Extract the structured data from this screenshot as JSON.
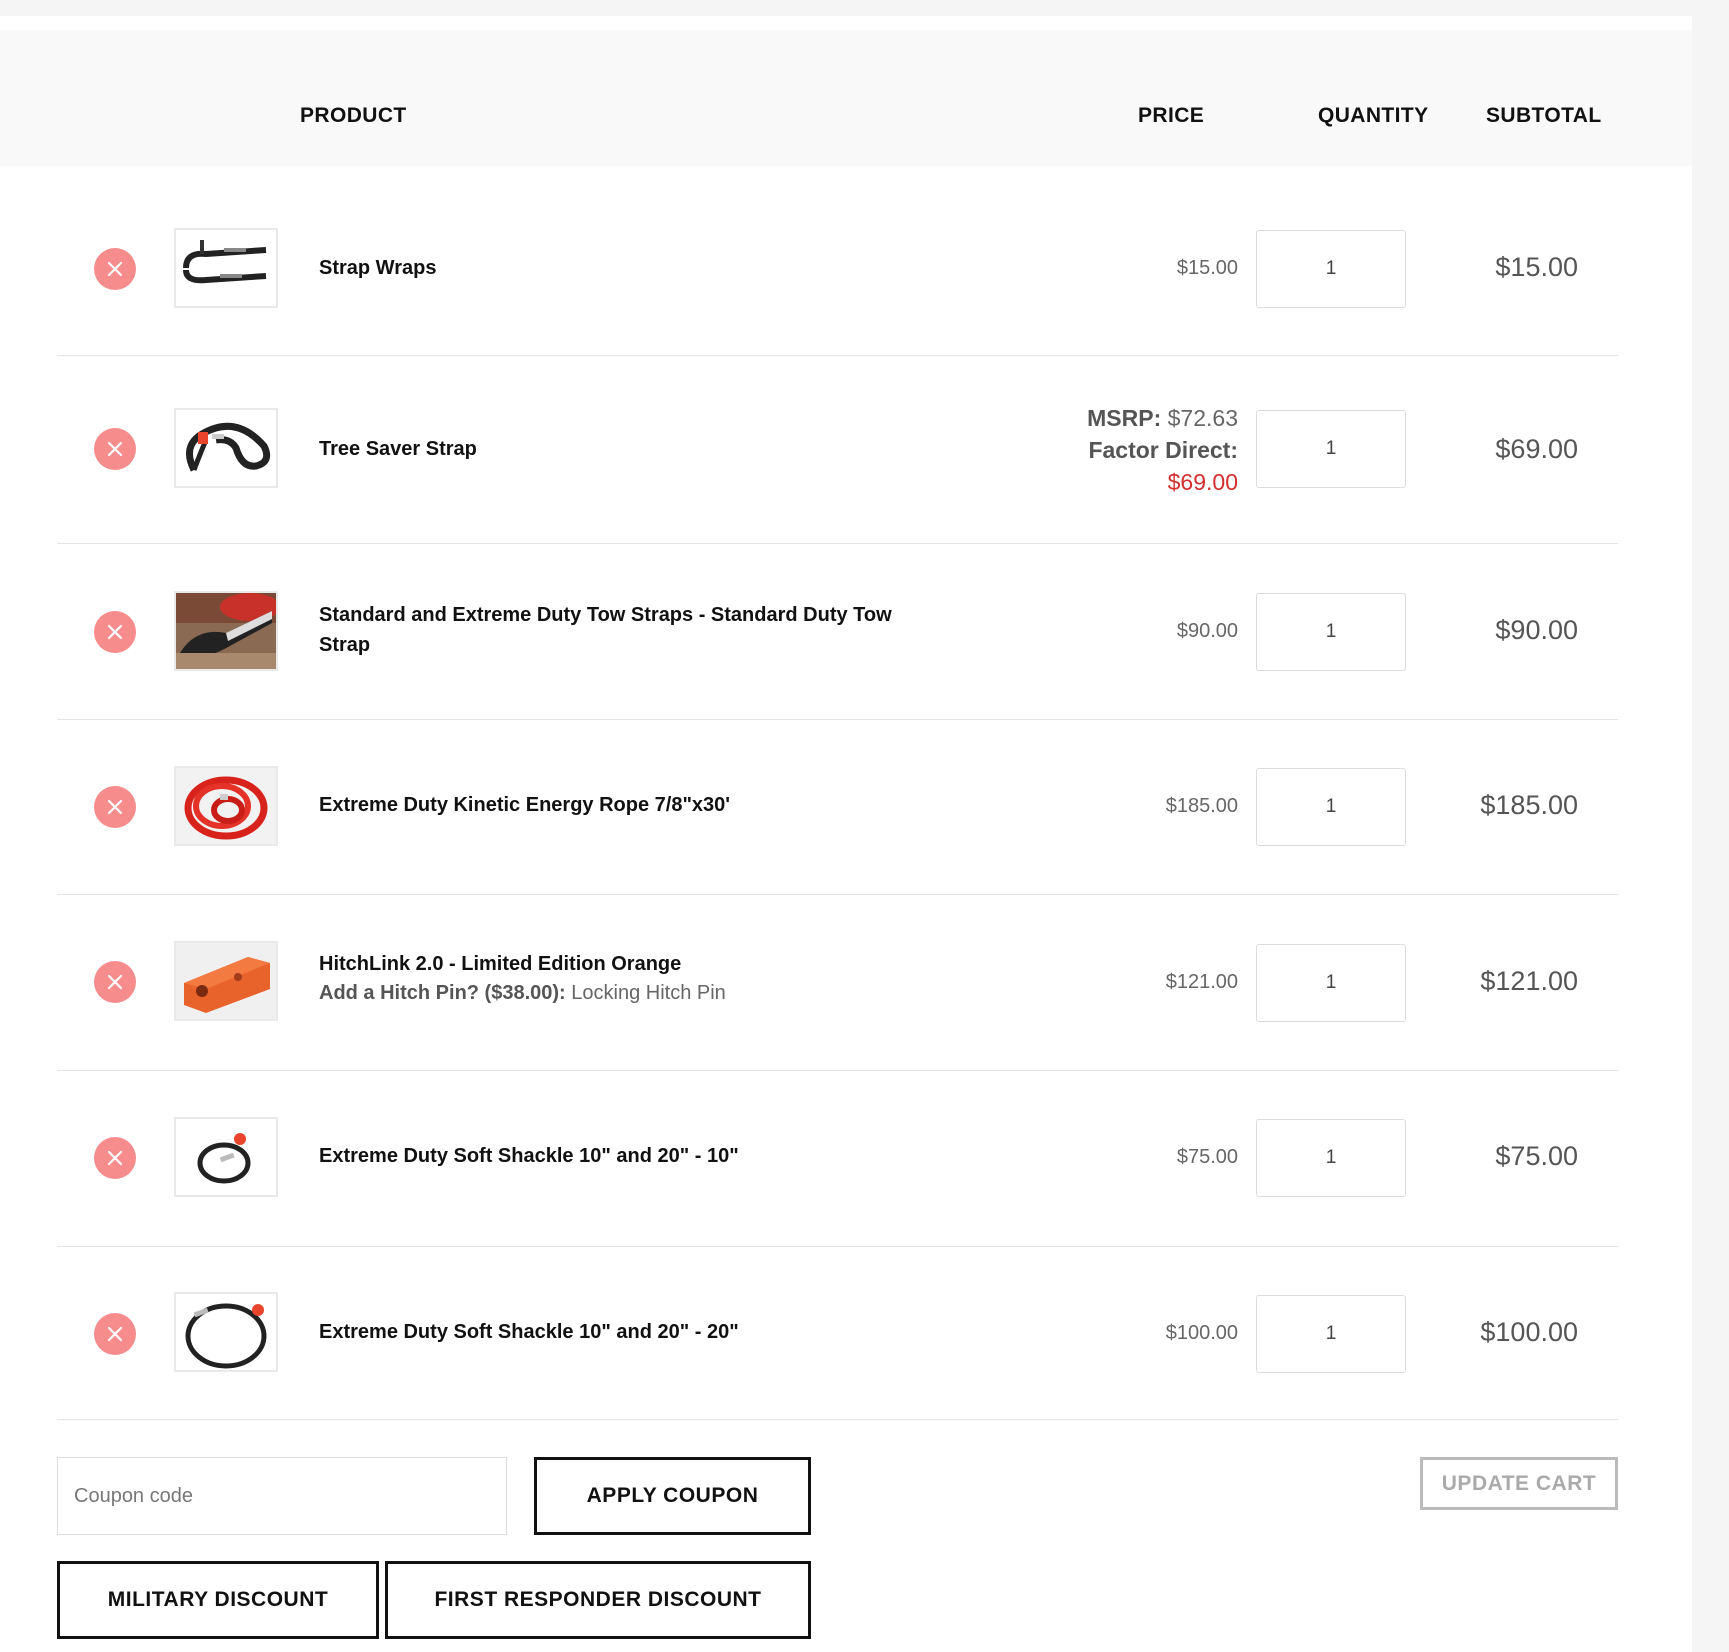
{
  "table": {
    "headers": {
      "product": "PRODUCT",
      "price": "PRICE",
      "quantity": "QUANTITY",
      "subtotal": "SUBTOTAL"
    },
    "rows": [
      {
        "name": "Strap Wraps",
        "price": "$15.00",
        "quantity": "1",
        "subtotal": "$15.00"
      },
      {
        "name": "Tree Saver Strap",
        "msrp_label": "MSRP:",
        "msrp_value": "$72.63",
        "direct_label": "Factor Direct:",
        "direct_value": "$69.00",
        "quantity": "1",
        "subtotal": "$69.00"
      },
      {
        "name": "Standard and Extreme Duty Tow Straps - Standard Duty Tow Strap",
        "price": "$90.00",
        "quantity": "1",
        "subtotal": "$90.00"
      },
      {
        "name": "Extreme Duty Kinetic Energy Rope 7/8\"x30'",
        "price": "$185.00",
        "quantity": "1",
        "subtotal": "$185.00"
      },
      {
        "name": "HitchLink 2.0 - Limited Edition Orange",
        "option_label": "Add a Hitch Pin? ($38.00):",
        "option_value": "Locking Hitch Pin",
        "price": "$121.00",
        "quantity": "1",
        "subtotal": "$121.00"
      },
      {
        "name": "Extreme Duty Soft Shackle 10\" and 20\" - 10\"",
        "price": "$75.00",
        "quantity": "1",
        "subtotal": "$75.00"
      },
      {
        "name": "Extreme Duty Soft Shackle 10\" and 20\" - 20\"",
        "price": "$100.00",
        "quantity": "1",
        "subtotal": "$100.00"
      }
    ]
  },
  "actions": {
    "coupon_placeholder": "Coupon code",
    "apply_coupon": "APPLY COUPON",
    "update_cart": "UPDATE CART",
    "military_discount": "MILITARY DISCOUNT",
    "first_responder_discount": "FIRST RESPONDER DISCOUNT"
  },
  "colors": {
    "remove_button": "#f78c8c",
    "sale_price": "#d32f2f",
    "header_bg": "#f9f9f9"
  }
}
